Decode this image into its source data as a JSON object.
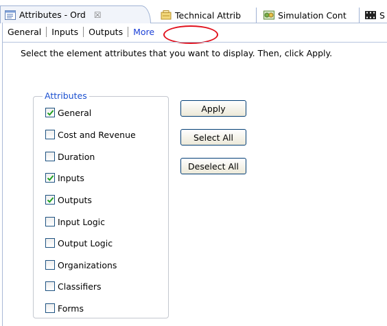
{
  "view_tabs": [
    {
      "label": "Attributes - Ord",
      "icon": "attributes-icon",
      "close": "☒"
    },
    {
      "label": "Technical Attrib",
      "icon": "technical-attributes-icon"
    },
    {
      "label": "Simulation Cont",
      "icon": "simulation-control-icon"
    },
    {
      "label": "S",
      "icon": "film-strip-icon"
    }
  ],
  "sub_tabs": [
    "General",
    "Inputs",
    "Outputs",
    "More"
  ],
  "selected_sub_tab": "More",
  "instruction": "Select the element attributes that you want to display. Then, click Apply.",
  "attributes": {
    "legend": "Attributes",
    "items": [
      {
        "label": "General",
        "checked": true
      },
      {
        "label": "Cost and Revenue",
        "checked": false
      },
      {
        "label": "Duration",
        "checked": false
      },
      {
        "label": "Inputs",
        "checked": true
      },
      {
        "label": "Outputs",
        "checked": true
      },
      {
        "label": "Input Logic",
        "checked": false
      },
      {
        "label": "Output Logic",
        "checked": false
      },
      {
        "label": "Organizations",
        "checked": false
      },
      {
        "label": "Classifiers",
        "checked": false
      },
      {
        "label": "Forms",
        "checked": false
      }
    ]
  },
  "buttons": {
    "apply": "Apply",
    "select_all": "Select All",
    "deselect_all": "Deselect All"
  },
  "colors": {
    "highlight": "#e1101c",
    "legend_text": "#1a4fd0",
    "selected_tab_text": "#1a3fd6",
    "check": "#21a121"
  }
}
